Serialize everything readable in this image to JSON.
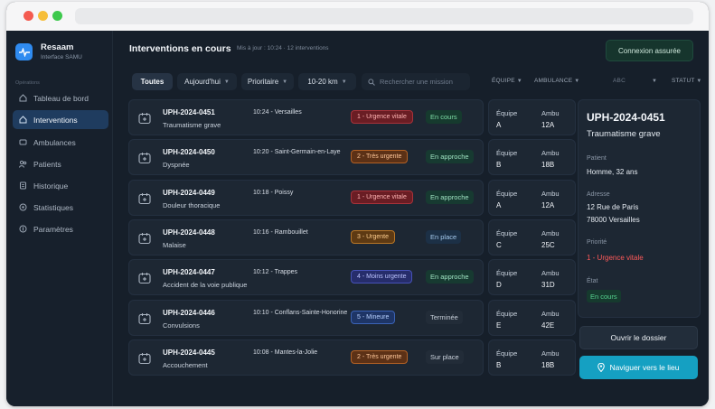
{
  "app": {
    "name": "Resaam",
    "subtitle": "Interface SAMU"
  },
  "sidebar": {
    "section_label": "Opérations",
    "items": [
      {
        "label": "Tableau de bord",
        "icon": "dashboard-icon"
      },
      {
        "label": "Interventions",
        "icon": "interventions-icon",
        "active": true
      },
      {
        "label": "Ambulances",
        "icon": "ambulance-icon"
      },
      {
        "label": "Patients",
        "icon": "patients-icon"
      },
      {
        "label": "Historique",
        "icon": "history-icon"
      },
      {
        "label": "Statistiques",
        "icon": "statistics-icon"
      },
      {
        "label": "Paramètres",
        "icon": "settings-icon"
      }
    ]
  },
  "header": {
    "title": "Interventions en cours",
    "updated": "Mis à jour : 10:24",
    "count": "12 interventions",
    "secure_label": "Connexion assurée"
  },
  "filters": {
    "all": "Toutes",
    "date": "Aujourd'hui",
    "priority": "Prioritaire",
    "distance": "10-20 km",
    "search_placeholder": "Rechercher une mission",
    "col_team": "ÉQUIPE",
    "col_ambulance": "AMBULANCE",
    "col_abc": "ABC",
    "col_status": "STATUT"
  },
  "colors": {
    "urgence_vitale": "#ff6b6b",
    "tres_urgente": "#ff9a52",
    "urgente": "#ffad4a",
    "moins_urgente": "#8f9bff",
    "mineure": "#6ea8ff",
    "en_cours": "#57d691",
    "accent": "#15a0c2"
  },
  "interventions": [
    {
      "id": "UPH-2024-0451",
      "type": "Traumatisme grave",
      "time_place": "10:24 - Versailles",
      "priority": "1 - Urgence vitale",
      "priority_level": 1,
      "status": "En cours",
      "team_label": "Équipe",
      "team": "A",
      "amb_label": "Ambu",
      "ambulance": "12A"
    },
    {
      "id": "UPH-2024-0450",
      "type": "Dyspnée",
      "time_place": "10:20 - Saint-Germain-en-Laye",
      "priority": "2 - Très urgente",
      "priority_level": 2,
      "status": "En approche",
      "team_label": "Équipe",
      "team": "B",
      "amb_label": "Ambu",
      "ambulance": "18B"
    },
    {
      "id": "UPH-2024-0449",
      "type": "Douleur thoracique",
      "time_place": "10:18 - Poissy",
      "priority": "1 - Urgence vitale",
      "priority_level": 1,
      "status": "En approche",
      "team_label": "Équipe",
      "team": "A",
      "amb_label": "Ambu",
      "ambulance": "12A"
    },
    {
      "id": "UPH-2024-0448",
      "type": "Malaise",
      "time_place": "10:16 - Rambouillet",
      "priority": "3 - Urgente",
      "priority_level": 3,
      "status": "En place",
      "team_label": "Équipe",
      "team": "C",
      "amb_label": "Ambu",
      "ambulance": "25C"
    },
    {
      "id": "UPH-2024-0447",
      "type": "Accident de la voie publique",
      "time_place": "10:12 - Trappes",
      "priority": "4 - Moins urgente",
      "priority_level": 4,
      "status": "En approche",
      "team_label": "Équipe",
      "team": "D",
      "amb_label": "Ambu",
      "ambulance": "31D"
    },
    {
      "id": "UPH-2024-0446",
      "type": "Convulsions",
      "time_place": "10:10 - Conflans-Sainte-Honorine",
      "priority": "5 - Mineure",
      "priority_level": 5,
      "status": "Terminée",
      "team_label": "Équipe",
      "team": "E",
      "amb_label": "Ambu",
      "ambulance": "42E"
    },
    {
      "id": "UPH-2024-0445",
      "type": "Accouchement",
      "time_place": "10:08 - Mantes-la-Jolie",
      "priority": "2 - Très urgente",
      "priority_level": 2,
      "status": "Sur place",
      "team_label": "Équipe",
      "team": "B",
      "amb_label": "Ambu",
      "ambulance": "18B"
    }
  ],
  "detail": {
    "id": "UPH-2024-0451",
    "type": "Traumatisme grave",
    "patient_label": "Patient",
    "patient": "Homme, 32 ans",
    "address_label": "Adresse",
    "address_line1": "12 Rue de Paris",
    "address_line2": "78000 Versailles",
    "priority_label": "Priorité",
    "priority": "1 - Urgence vitale",
    "status_label": "État",
    "status": "En cours",
    "open_button": "Ouvrir le dossier",
    "navigate_button": "Naviguer vers le lieu"
  }
}
